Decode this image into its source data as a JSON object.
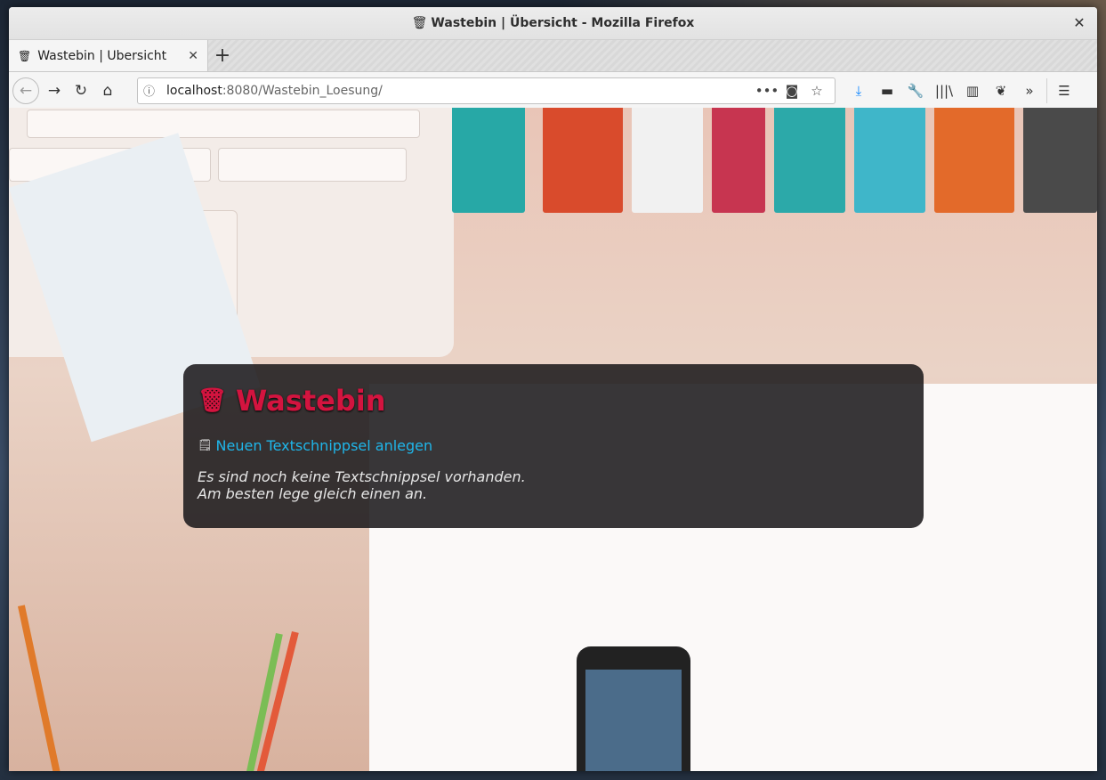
{
  "window": {
    "title": "Wastebin | Übersicht - Mozilla Firefox",
    "title_icon": "🗑",
    "close": "✕"
  },
  "tabs": [
    {
      "label": "Wastebin | Übersicht",
      "favicon": "🗑",
      "close": "✕"
    }
  ],
  "newtab_label": "+",
  "nav": {
    "back": "←",
    "forward": "→",
    "reload": "↻",
    "home": "⌂"
  },
  "url": {
    "info_icon": "ⓘ",
    "host": "localhost",
    "rest": ":8080/Wastebin_Loesung/",
    "more": "•••",
    "pocket": "◙",
    "bookmark": "☆"
  },
  "toolbar_icons": [
    "download-icon",
    "hat-icon",
    "wrench-icon",
    "library-icon",
    "sidebar-icon",
    "gnome-icon",
    "overflow-icon",
    "menu-icon"
  ],
  "toolbar_glyphs": {
    "download": "⤓",
    "hat": "▬",
    "wrench": "🔧",
    "library": "|||\\",
    "sidebar": "▥",
    "gnome": "❦",
    "overflow": "»",
    "menu": "☰"
  },
  "page": {
    "app_icon": "🗑",
    "app_title": "Wastebin",
    "new_icon": "🗒",
    "new_link": "Neuen Textschnippsel anlegen",
    "empty_line1": "Es sind noch keine Textschnippsel vorhanden.",
    "empty_line2": "Am besten lege gleich einen an."
  },
  "colors": {
    "title_red": "#d3143f",
    "link_blue": "#1fb6ea",
    "download_blue": "#0a84ff"
  }
}
